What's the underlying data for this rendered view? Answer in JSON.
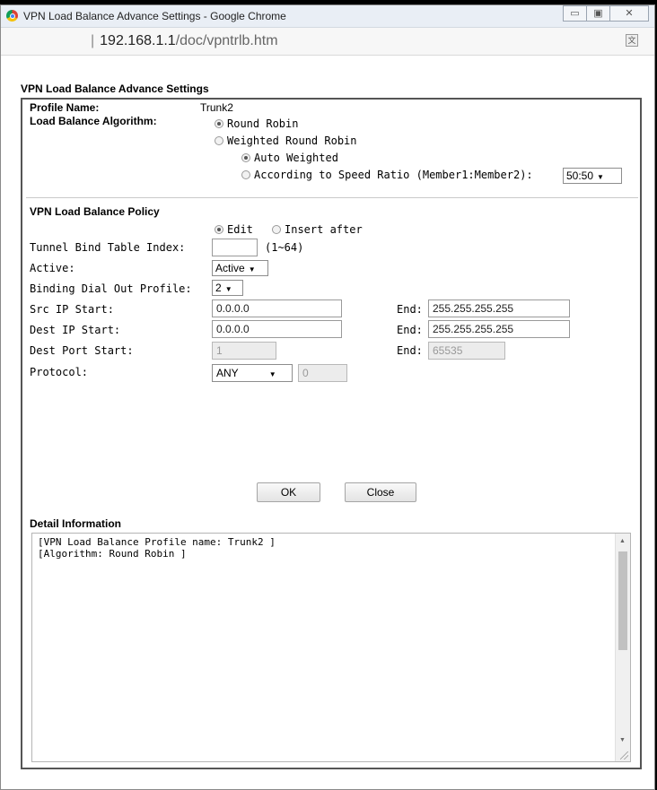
{
  "window": {
    "title": "VPN Load Balance Advance Settings - Google Chrome",
    "controls": {
      "minimize": "▭",
      "maximize": "▣",
      "close": "✕"
    }
  },
  "address_bar": {
    "host": "192.168.1.1",
    "path": "/doc/vpntrlb.htm",
    "translate_icon": "translate-icon"
  },
  "page": {
    "heading": "VPN Load Balance Advance Settings",
    "profile": {
      "label": "Profile Name:",
      "value": "Trunk2"
    },
    "algorithm": {
      "label": "Load Balance Algorithm:",
      "options": [
        "Round Robin",
        "Weighted Round Robin"
      ],
      "selected": "Round Robin",
      "sub_options": [
        "Auto Weighted",
        "According to Speed Ratio (Member1:Member2):"
      ],
      "sub_selected": "Auto Weighted",
      "ratio": "50:50"
    },
    "policy": {
      "heading": "VPN Load Balance Policy",
      "mode_options": [
        "Edit",
        "Insert after"
      ],
      "mode_selected": "Edit",
      "index_label": "Tunnel Bind Table Index:",
      "index_value": "",
      "index_range": "(1~64)",
      "active_label": "Active:",
      "active_value": "Active",
      "dialout_label": "Binding Dial Out Profile:",
      "dialout_value": "2",
      "src_label": "Src IP Start:",
      "src_start": "0.0.0.0",
      "src_end": "255.255.255.255",
      "dest_label": "Dest IP Start:",
      "dest_start": "0.0.0.0",
      "dest_end": "255.255.255.255",
      "port_label": "Dest Port Start:",
      "port_start": "1",
      "port_end": "65535",
      "end_label": "End:",
      "protocol_label": "Protocol:",
      "protocol_value": "ANY",
      "protocol_num": "0"
    },
    "buttons": {
      "ok": "OK",
      "close": "Close"
    },
    "detail": {
      "heading": "Detail Information",
      "text": "[VPN Load Balance Profile name: Trunk2 ]\n[Algorithm: Round Robin ]"
    }
  }
}
